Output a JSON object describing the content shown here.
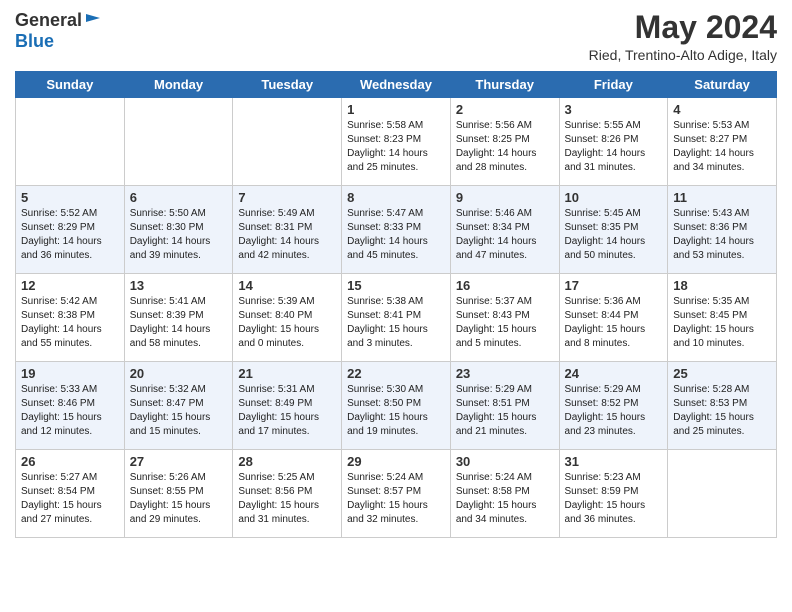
{
  "header": {
    "logo_general": "General",
    "logo_blue": "Blue",
    "month_title": "May 2024",
    "location": "Ried, Trentino-Alto Adige, Italy"
  },
  "weekdays": [
    "Sunday",
    "Monday",
    "Tuesday",
    "Wednesday",
    "Thursday",
    "Friday",
    "Saturday"
  ],
  "weeks": [
    [
      {
        "day": "",
        "sunrise": "",
        "sunset": "",
        "daylight": ""
      },
      {
        "day": "",
        "sunrise": "",
        "sunset": "",
        "daylight": ""
      },
      {
        "day": "",
        "sunrise": "",
        "sunset": "",
        "daylight": ""
      },
      {
        "day": "1",
        "sunrise": "Sunrise: 5:58 AM",
        "sunset": "Sunset: 8:23 PM",
        "daylight": "Daylight: 14 hours and 25 minutes."
      },
      {
        "day": "2",
        "sunrise": "Sunrise: 5:56 AM",
        "sunset": "Sunset: 8:25 PM",
        "daylight": "Daylight: 14 hours and 28 minutes."
      },
      {
        "day": "3",
        "sunrise": "Sunrise: 5:55 AM",
        "sunset": "Sunset: 8:26 PM",
        "daylight": "Daylight: 14 hours and 31 minutes."
      },
      {
        "day": "4",
        "sunrise": "Sunrise: 5:53 AM",
        "sunset": "Sunset: 8:27 PM",
        "daylight": "Daylight: 14 hours and 34 minutes."
      }
    ],
    [
      {
        "day": "5",
        "sunrise": "Sunrise: 5:52 AM",
        "sunset": "Sunset: 8:29 PM",
        "daylight": "Daylight: 14 hours and 36 minutes."
      },
      {
        "day": "6",
        "sunrise": "Sunrise: 5:50 AM",
        "sunset": "Sunset: 8:30 PM",
        "daylight": "Daylight: 14 hours and 39 minutes."
      },
      {
        "day": "7",
        "sunrise": "Sunrise: 5:49 AM",
        "sunset": "Sunset: 8:31 PM",
        "daylight": "Daylight: 14 hours and 42 minutes."
      },
      {
        "day": "8",
        "sunrise": "Sunrise: 5:47 AM",
        "sunset": "Sunset: 8:33 PM",
        "daylight": "Daylight: 14 hours and 45 minutes."
      },
      {
        "day": "9",
        "sunrise": "Sunrise: 5:46 AM",
        "sunset": "Sunset: 8:34 PM",
        "daylight": "Daylight: 14 hours and 47 minutes."
      },
      {
        "day": "10",
        "sunrise": "Sunrise: 5:45 AM",
        "sunset": "Sunset: 8:35 PM",
        "daylight": "Daylight: 14 hours and 50 minutes."
      },
      {
        "day": "11",
        "sunrise": "Sunrise: 5:43 AM",
        "sunset": "Sunset: 8:36 PM",
        "daylight": "Daylight: 14 hours and 53 minutes."
      }
    ],
    [
      {
        "day": "12",
        "sunrise": "Sunrise: 5:42 AM",
        "sunset": "Sunset: 8:38 PM",
        "daylight": "Daylight: 14 hours and 55 minutes."
      },
      {
        "day": "13",
        "sunrise": "Sunrise: 5:41 AM",
        "sunset": "Sunset: 8:39 PM",
        "daylight": "Daylight: 14 hours and 58 minutes."
      },
      {
        "day": "14",
        "sunrise": "Sunrise: 5:39 AM",
        "sunset": "Sunset: 8:40 PM",
        "daylight": "Daylight: 15 hours and 0 minutes."
      },
      {
        "day": "15",
        "sunrise": "Sunrise: 5:38 AM",
        "sunset": "Sunset: 8:41 PM",
        "daylight": "Daylight: 15 hours and 3 minutes."
      },
      {
        "day": "16",
        "sunrise": "Sunrise: 5:37 AM",
        "sunset": "Sunset: 8:43 PM",
        "daylight": "Daylight: 15 hours and 5 minutes."
      },
      {
        "day": "17",
        "sunrise": "Sunrise: 5:36 AM",
        "sunset": "Sunset: 8:44 PM",
        "daylight": "Daylight: 15 hours and 8 minutes."
      },
      {
        "day": "18",
        "sunrise": "Sunrise: 5:35 AM",
        "sunset": "Sunset: 8:45 PM",
        "daylight": "Daylight: 15 hours and 10 minutes."
      }
    ],
    [
      {
        "day": "19",
        "sunrise": "Sunrise: 5:33 AM",
        "sunset": "Sunset: 8:46 PM",
        "daylight": "Daylight: 15 hours and 12 minutes."
      },
      {
        "day": "20",
        "sunrise": "Sunrise: 5:32 AM",
        "sunset": "Sunset: 8:47 PM",
        "daylight": "Daylight: 15 hours and 15 minutes."
      },
      {
        "day": "21",
        "sunrise": "Sunrise: 5:31 AM",
        "sunset": "Sunset: 8:49 PM",
        "daylight": "Daylight: 15 hours and 17 minutes."
      },
      {
        "day": "22",
        "sunrise": "Sunrise: 5:30 AM",
        "sunset": "Sunset: 8:50 PM",
        "daylight": "Daylight: 15 hours and 19 minutes."
      },
      {
        "day": "23",
        "sunrise": "Sunrise: 5:29 AM",
        "sunset": "Sunset: 8:51 PM",
        "daylight": "Daylight: 15 hours and 21 minutes."
      },
      {
        "day": "24",
        "sunrise": "Sunrise: 5:29 AM",
        "sunset": "Sunset: 8:52 PM",
        "daylight": "Daylight: 15 hours and 23 minutes."
      },
      {
        "day": "25",
        "sunrise": "Sunrise: 5:28 AM",
        "sunset": "Sunset: 8:53 PM",
        "daylight": "Daylight: 15 hours and 25 minutes."
      }
    ],
    [
      {
        "day": "26",
        "sunrise": "Sunrise: 5:27 AM",
        "sunset": "Sunset: 8:54 PM",
        "daylight": "Daylight: 15 hours and 27 minutes."
      },
      {
        "day": "27",
        "sunrise": "Sunrise: 5:26 AM",
        "sunset": "Sunset: 8:55 PM",
        "daylight": "Daylight: 15 hours and 29 minutes."
      },
      {
        "day": "28",
        "sunrise": "Sunrise: 5:25 AM",
        "sunset": "Sunset: 8:56 PM",
        "daylight": "Daylight: 15 hours and 31 minutes."
      },
      {
        "day": "29",
        "sunrise": "Sunrise: 5:24 AM",
        "sunset": "Sunset: 8:57 PM",
        "daylight": "Daylight: 15 hours and 32 minutes."
      },
      {
        "day": "30",
        "sunrise": "Sunrise: 5:24 AM",
        "sunset": "Sunset: 8:58 PM",
        "daylight": "Daylight: 15 hours and 34 minutes."
      },
      {
        "day": "31",
        "sunrise": "Sunrise: 5:23 AM",
        "sunset": "Sunset: 8:59 PM",
        "daylight": "Daylight: 15 hours and 36 minutes."
      },
      {
        "day": "",
        "sunrise": "",
        "sunset": "",
        "daylight": ""
      }
    ]
  ]
}
